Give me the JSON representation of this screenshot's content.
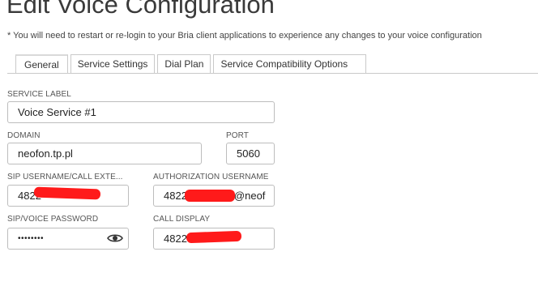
{
  "page": {
    "title": "Edit Voice Configuration",
    "note": "* You will need to restart or re-login to your Bria client applications to experience any changes to your voice configuration"
  },
  "tabs": [
    {
      "label": "General",
      "active": true
    },
    {
      "label": "Service Settings",
      "active": false
    },
    {
      "label": "Dial Plan",
      "active": false
    },
    {
      "label": "Service Compatibility Options",
      "active": false
    }
  ],
  "form": {
    "service_label": {
      "label": "SERVICE LABEL",
      "value": "Voice Service #1"
    },
    "domain": {
      "label": "DOMAIN",
      "value": "neofon.tp.pl"
    },
    "port": {
      "label": "PORT",
      "value": "5060"
    },
    "sip_username": {
      "label": "SIP USERNAME/CALL EXTE...",
      "value": "4822"
    },
    "authorization_username": {
      "label": "AUTHORIZATION USERNAME",
      "value_prefix": "4822",
      "value_suffix": "@neof"
    },
    "sip_password": {
      "label": "SIP/VOICE PASSWORD",
      "value": "••••••••",
      "reveal_icon": "eye-icon"
    },
    "call_display": {
      "label": "CALL DISPLAY",
      "value": "4822"
    }
  },
  "colors": {
    "redaction": "#ff1a1a",
    "border": "#bdbdbd"
  }
}
